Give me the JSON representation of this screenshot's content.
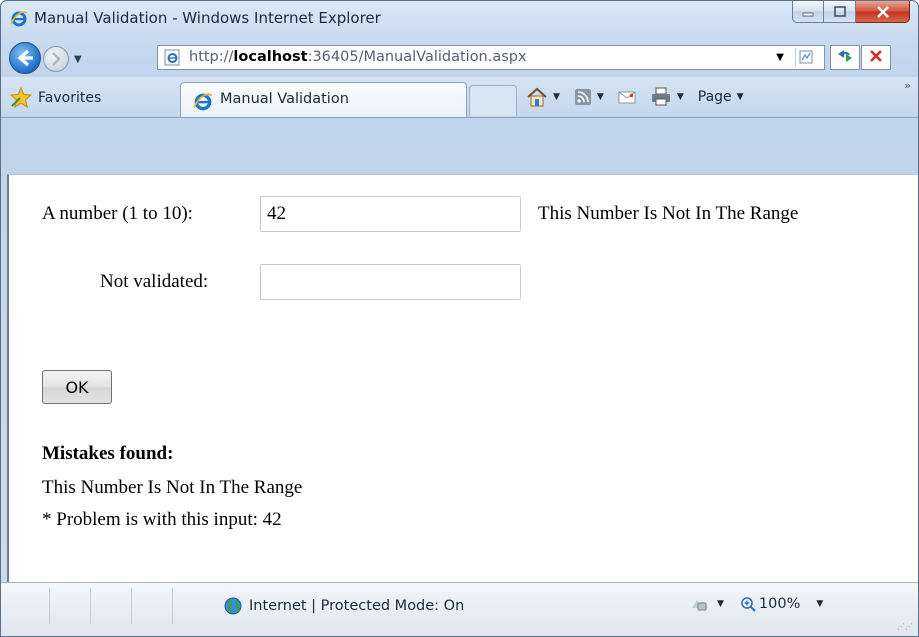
{
  "window": {
    "title": "Manual Validation - Windows Internet Explorer"
  },
  "addressbar": {
    "url_prefix": "http://",
    "url_host": "localhost",
    "url_rest": ":36405/ManualValidation.aspx"
  },
  "favorites": {
    "label": "Favorites"
  },
  "tab": {
    "label": "Manual Validation"
  },
  "commandbar": {
    "page_label": "Page",
    "overflow": "»"
  },
  "form": {
    "number_label": "A number (1 to 10):",
    "number_value": "42",
    "number_error": "This Number Is Not In The Range",
    "notvalidated_label": "Not validated:",
    "notvalidated_value": "",
    "ok_label": "OK"
  },
  "summary": {
    "heading": "Mistakes found:",
    "message": "This Number Is Not In The Range",
    "detail": "* Problem is with this input: 42"
  },
  "statusbar": {
    "zone_text": "Internet | Protected Mode: On",
    "zoom": "100%"
  }
}
